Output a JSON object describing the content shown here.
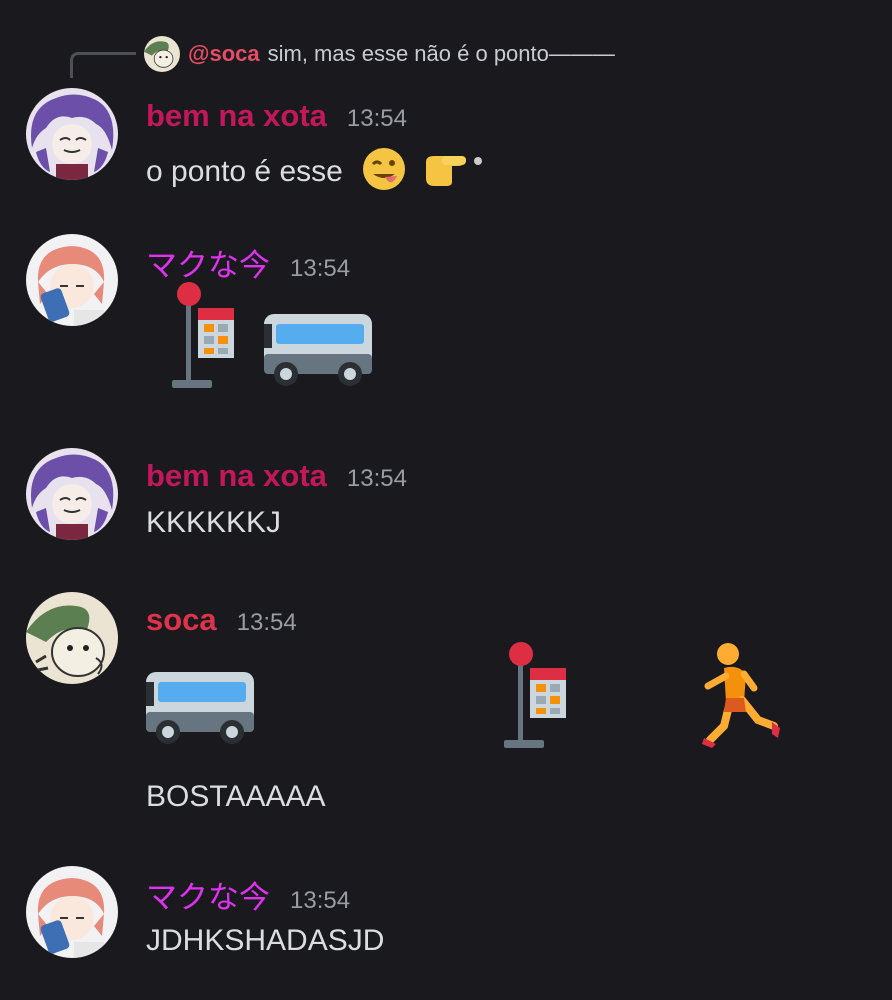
{
  "reply": {
    "mention": "@soca",
    "snippet": "sim, mas esse não é o ponto———"
  },
  "messages": [
    {
      "author": "bem na xota",
      "time": "13:54",
      "text": "o ponto é esse",
      "emojis": [
        "tongue-wink-emoji",
        "pointing-right-emoji"
      ],
      "name_color": "#c2185b"
    },
    {
      "author": "マクな今",
      "time": "13:54",
      "emojis": [
        "bus-stop-emoji",
        "bus-emoji"
      ],
      "name_color": "#dd33ee"
    },
    {
      "author": "bem na xota",
      "time": "13:54",
      "text": "KKKKKKJ",
      "name_color": "#c2185b"
    },
    {
      "author": "soca",
      "time": "13:54",
      "emojis": [
        "bus-emoji",
        "bus-stop-emoji",
        "person-running-emoji"
      ],
      "text": "BOSTAAAAA",
      "name_color": "#e0324b"
    },
    {
      "author": "マクな今",
      "time": "13:54",
      "text": "JDHKSHADASJD",
      "name_color": "#dd33ee"
    }
  ]
}
